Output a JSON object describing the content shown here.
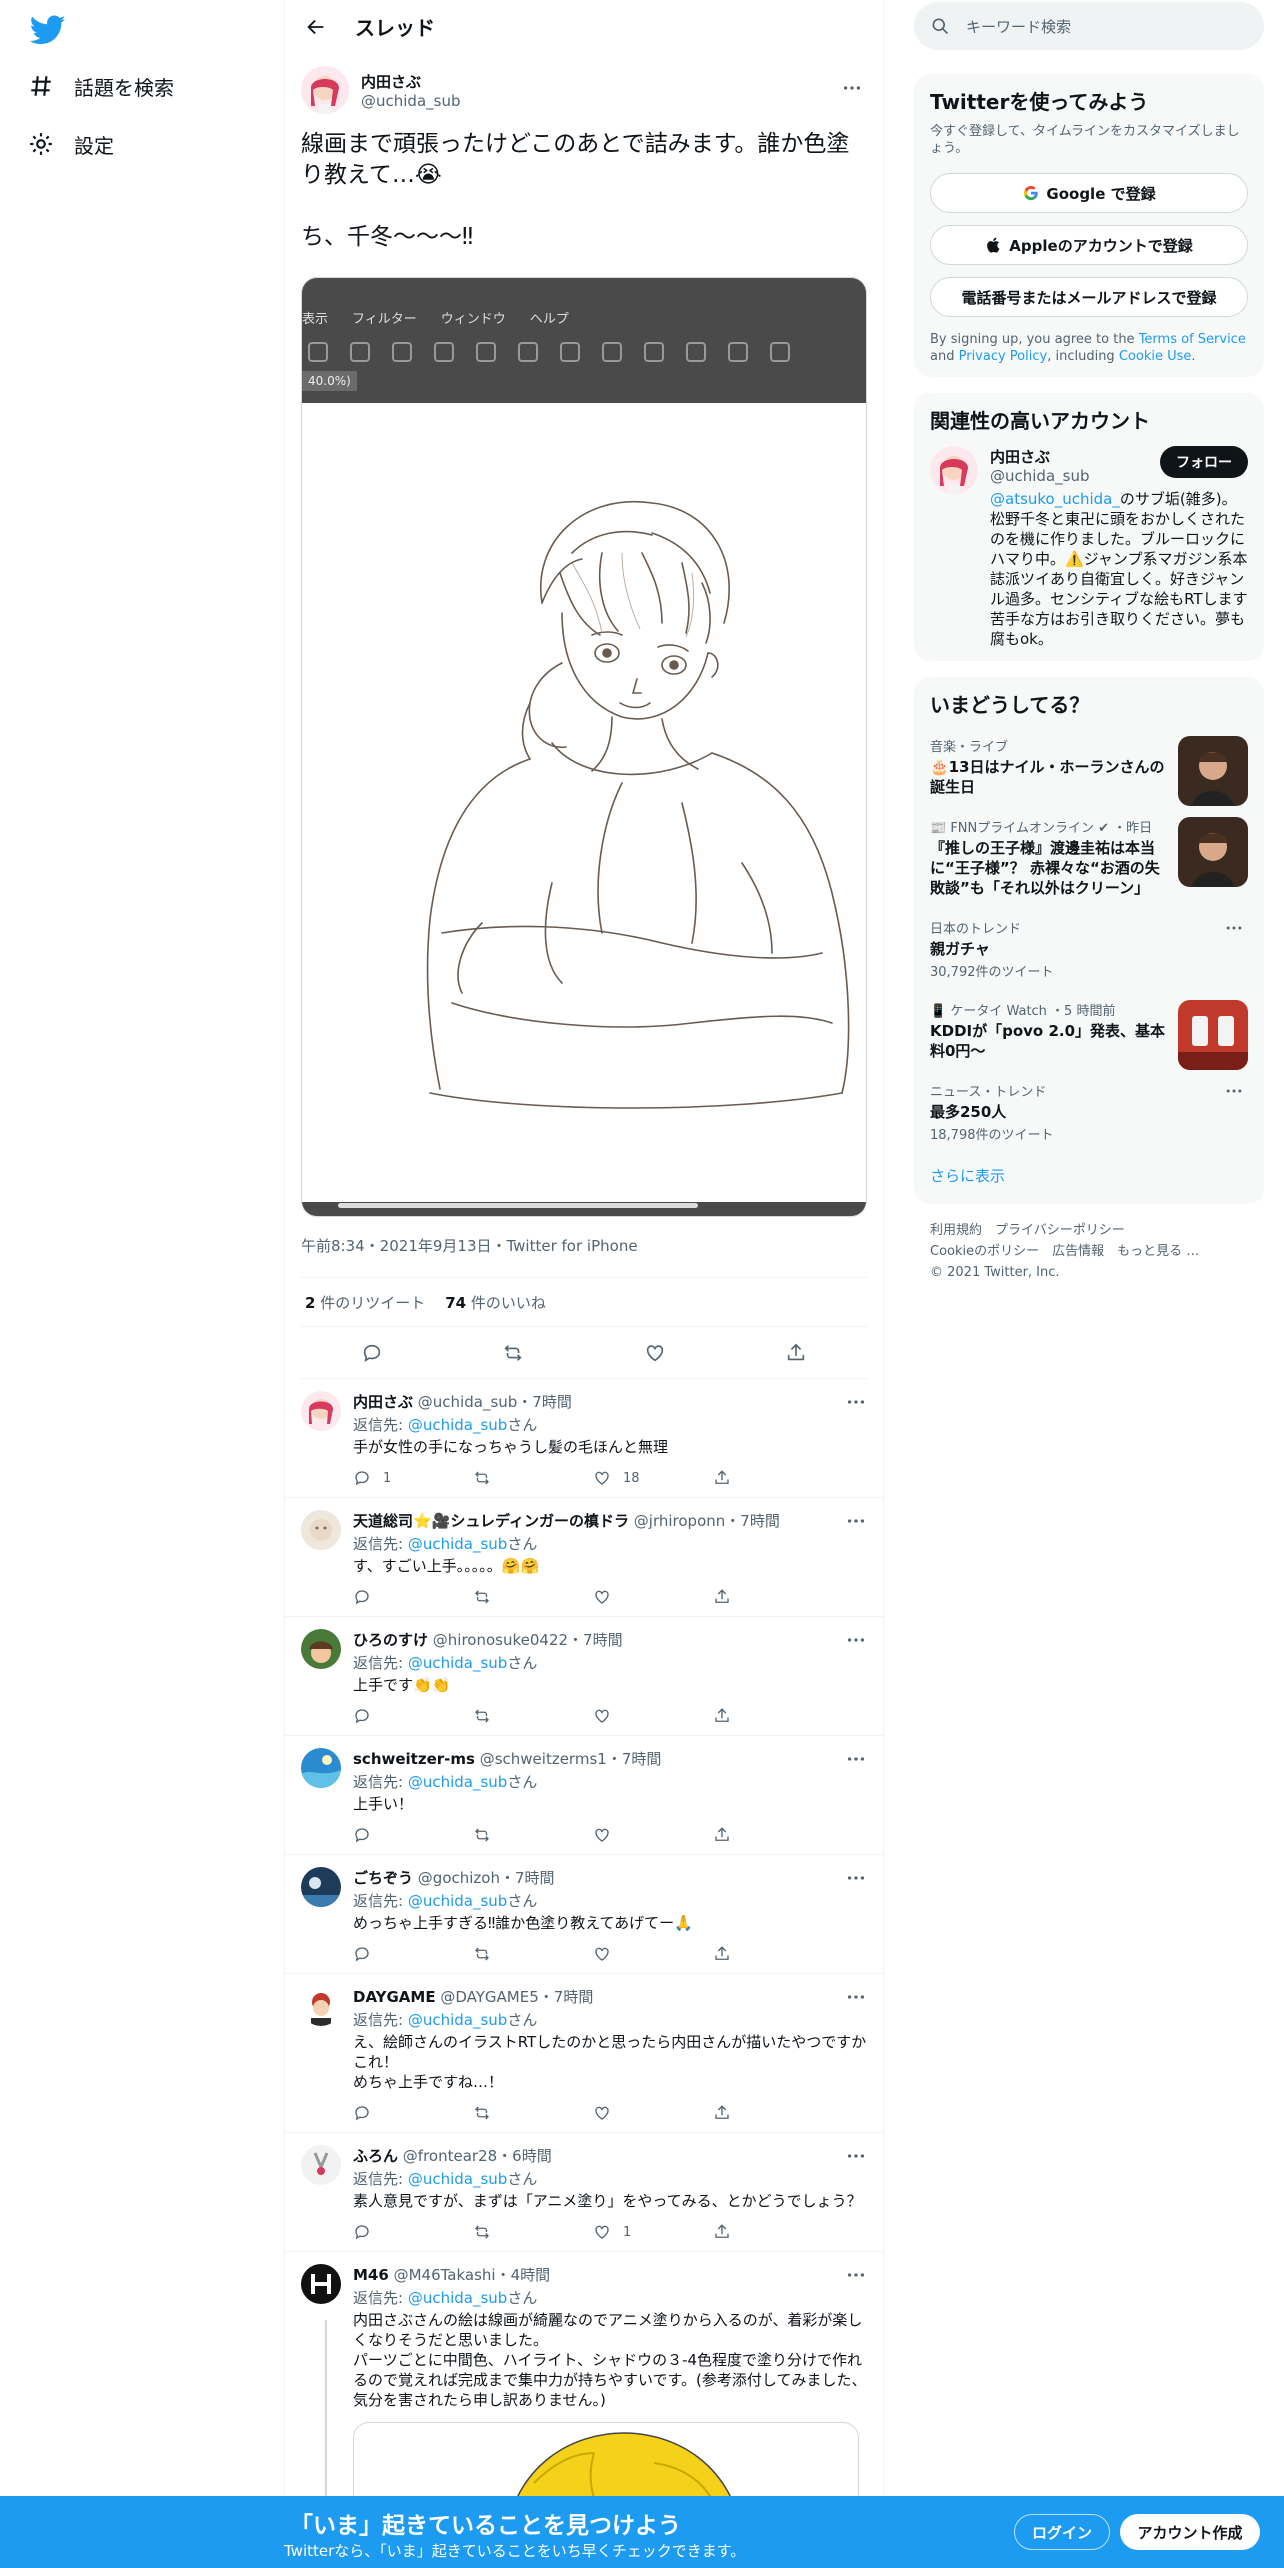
{
  "nav": {
    "items": [
      {
        "label": "話題を検索",
        "icon": "hashtag-icon"
      },
      {
        "label": "設定",
        "icon": "gear-icon"
      }
    ]
  },
  "header": {
    "title": "スレッド"
  },
  "focal": {
    "name": "内田さぶ",
    "handle": "@uchida_sub",
    "text": "線画まで頑張ったけどこのあとで詰みます。誰か色塗り教えて…😭\n\nち、千冬〜〜〜‼",
    "app_menu": [
      "表示",
      "フィルター",
      "ウィンドウ",
      "ヘルプ"
    ],
    "zoom": "40.0%)",
    "meta": "午前8:34・2021年9月13日・Twitter for iPhone",
    "retweets": "2",
    "retweets_label": "件のリツイート",
    "likes": "74",
    "likes_label": "件のいいね"
  },
  "replies": [
    {
      "name": "内田さぶ",
      "handle": "@uchida_sub",
      "time": "・7時間",
      "reply_to_label": "返信先:",
      "reply_to": "@uchida_sub",
      "reply_suffix": "さん",
      "text": "手が女性の手になっちゃうし髪の毛ほんと無理",
      "replies": "1",
      "retweets": "",
      "likes": "18"
    },
    {
      "name": "天道総司⭐️🎥シュレディンガーの槙ドラ",
      "handle": "@jrhiroponn",
      "time": "・7時間",
      "reply_to_label": "返信先:",
      "reply_to": "@uchida_sub",
      "reply_suffix": "さん",
      "text": "す、すごい上手。。。。。🤗🤗",
      "replies": "",
      "retweets": "",
      "likes": ""
    },
    {
      "name": "ひろのすけ",
      "handle": "@hironosuke0422",
      "time": "・7時間",
      "reply_to_label": "返信先:",
      "reply_to": "@uchida_sub",
      "reply_suffix": "さん",
      "text": "上手です👏👏",
      "replies": "",
      "retweets": "",
      "likes": ""
    },
    {
      "name": "schweitzer-ms",
      "handle": "@schweitzerms1",
      "time": "・7時間",
      "reply_to_label": "返信先:",
      "reply_to": "@uchida_sub",
      "reply_suffix": "さん",
      "text": "上手い！",
      "replies": "",
      "retweets": "",
      "likes": ""
    },
    {
      "name": "ごちぞう",
      "handle": "@gochizoh",
      "time": "・7時間",
      "reply_to_label": "返信先:",
      "reply_to": "@uchida_sub",
      "reply_suffix": "さん",
      "text": "めっちゃ上手すぎる‼誰か色塗り教えてあげてー🙏",
      "replies": "",
      "retweets": "",
      "likes": ""
    },
    {
      "name": "DAYGAME",
      "handle": "@DAYGAME5",
      "time": "・7時間",
      "reply_to_label": "返信先:",
      "reply_to": "@uchida_sub",
      "reply_suffix": "さん",
      "text": "え、絵師さんのイラストRTしたのかと思ったら内田さんが描いたやつですかこれ！\nめちゃ上手ですね…！",
      "replies": "",
      "retweets": "",
      "likes": ""
    },
    {
      "name": "ふろん",
      "handle": "@frontear28",
      "time": "・6時間",
      "reply_to_label": "返信先:",
      "reply_to": "@uchida_sub",
      "reply_suffix": "さん",
      "text": "素人意見ですが、まずは「アニメ塗り」をやってみる、とかどうでしょう？",
      "replies": "",
      "retweets": "",
      "likes": "1"
    },
    {
      "name": "M46",
      "handle": "@M46Takashi",
      "time": "・4時間",
      "reply_to_label": "返信先:",
      "reply_to": "@uchida_sub",
      "reply_suffix": "さん",
      "text": "内田さぶさんの絵は線画が綺麗なのでアニメ塗りから入るのが、着彩が楽しくなりそうだと思いました。\nパーツごとに中間色、ハイライト、シャドウの３-4色程度で塗り分けで作れるので覚えれば完成まで集中力が持ちやすいです。(参考添付してみました、気分を害されたら申し訳ありません。)",
      "replies": "",
      "retweets": "",
      "likes": ""
    }
  ],
  "sidebar": {
    "search_placeholder": "キーワード検索",
    "signup": {
      "title": "Twitterを使ってみよう",
      "subtitle": "今すぐ登録して、タイムラインをカスタマイズしましょう。",
      "google": "Google で登録",
      "apple": "Appleのアカウントで登録",
      "phone": "電話番号またはメールアドレスで登録",
      "terms_pre": "By signing up, you agree to the",
      "terms_link": "Terms of Service",
      "terms_and": "and",
      "privacy_link": "Privacy Policy",
      "terms_mid": ", including",
      "cookie_link": "Cookie Use",
      "terms_end": "."
    },
    "relevant": {
      "title": "関連性の高いアカウント",
      "name": "内田さぶ",
      "handle": "@uchida_sub",
      "follow": "フォロー",
      "bio_link": "@atsuko_uchida_",
      "bio": "のサブ垢(雑多)。松野千冬と東卍に頭をおかしくされたのを機に作りました。ブルーロックにハマり中。⚠️ジャンプ系マガジン系本誌派ツイあり自衛宜しく。好きジャンル過多。センシティブな絵もRTします苦手な方はお引き取りください。夢も腐もok。"
    },
    "trends": {
      "title": "いまどうしてる？",
      "items": [
        {
          "category": "音楽・ライブ",
          "title": "🎂13日はナイル・ホーランさんの誕生日",
          "count": "",
          "thumb": "person-photo"
        },
        {
          "category": "📰 FNNプライムオンライン ✔ ・昨日",
          "title": "『推しの王子様』渡邊圭祐は本当に“王子様”？ 赤裸々な“お酒の失敗談”も「それ以外はクリーン」",
          "count": "",
          "thumb": "person-photo"
        },
        {
          "category": "日本のトレンド",
          "title": "親ガチャ",
          "count": "30,792件のツイート",
          "thumb": ""
        },
        {
          "category": "📱 ケータイ Watch ・5 時間前",
          "title": "KDDIが「povo 2.0」発表、基本料0円〜",
          "count": "",
          "thumb": "phone-photo"
        },
        {
          "category": "ニュース・トレンド",
          "title": "最多250人",
          "count": "18,798件のツイート",
          "thumb": ""
        }
      ],
      "show_more": "さらに表示"
    },
    "footer": {
      "line1": "利用規約　プライバシーポリシー",
      "line2": "Cookieのポリシー　広告情報　もっと見る …",
      "line3": "© 2021 Twitter, Inc."
    }
  },
  "bottom": {
    "title": "「いま」起きていることを見つけよう",
    "subtitle": "Twitterなら、「いま」起きていることをいち早くチェックできます。",
    "login": "ログイン",
    "signup": "アカウント作成"
  },
  "colors": {
    "accent": "#1d9bf0",
    "text": "#0f1419",
    "muted": "#536471"
  }
}
